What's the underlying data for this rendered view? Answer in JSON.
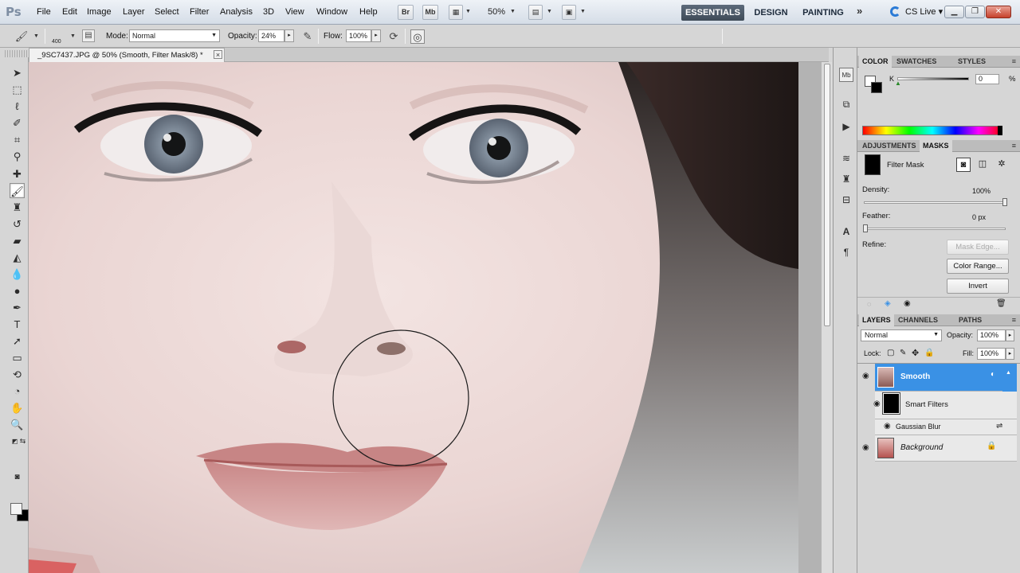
{
  "menubar": {
    "logo": "Ps",
    "items": [
      "File",
      "Edit",
      "Image",
      "Layer",
      "Select",
      "Filter",
      "Analysis",
      "3D",
      "View",
      "Window",
      "Help"
    ],
    "bridge_label": "Br",
    "minibridge_label": "Mb",
    "zoom": "50%",
    "workspaces": {
      "essentials": "ESSENTIALS",
      "design": "DESIGN",
      "painting": "PAINTING",
      "more": "»"
    },
    "cslive": "CS Live"
  },
  "options": {
    "brush_size": "400",
    "mode_label": "Mode:",
    "mode_value": "Normal",
    "opacity_label": "Opacity:",
    "opacity_value": "24%",
    "flow_label": "Flow:",
    "flow_value": "100%"
  },
  "document": {
    "tab_title": "_9SC7437.JPG @ 50% (Smooth, Filter Mask/8) *",
    "close": "×"
  },
  "color_panel": {
    "tabs": [
      "COLOR",
      "SWATCHES",
      "STYLES"
    ],
    "channel": "K",
    "value": "0",
    "unit": "%"
  },
  "masks_panel": {
    "tabs": [
      "ADJUSTMENTS",
      "MASKS"
    ],
    "mask_name": "Filter Mask",
    "density_label": "Density:",
    "density_value": "100%",
    "feather_label": "Feather:",
    "feather_value": "0 px",
    "refine_label": "Refine:",
    "mask_edge": "Mask Edge...",
    "color_range": "Color Range...",
    "invert": "Invert"
  },
  "layers_panel": {
    "tabs": [
      "LAYERS",
      "CHANNELS",
      "PATHS"
    ],
    "blend_mode": "Normal",
    "opacity_label": "Opacity:",
    "opacity_value": "100%",
    "lock_label": "Lock:",
    "fill_label": "Fill:",
    "fill_value": "100%",
    "layers": [
      {
        "name": "Smooth",
        "selected": true
      },
      {
        "name": "Smart Filters"
      },
      {
        "name": "Gaussian Blur"
      },
      {
        "name": "Background"
      }
    ]
  },
  "colors": {
    "accent": "#3a91e5",
    "panel_bg": "#d6d6d6",
    "menubar_bg": "#e3e9f0"
  }
}
